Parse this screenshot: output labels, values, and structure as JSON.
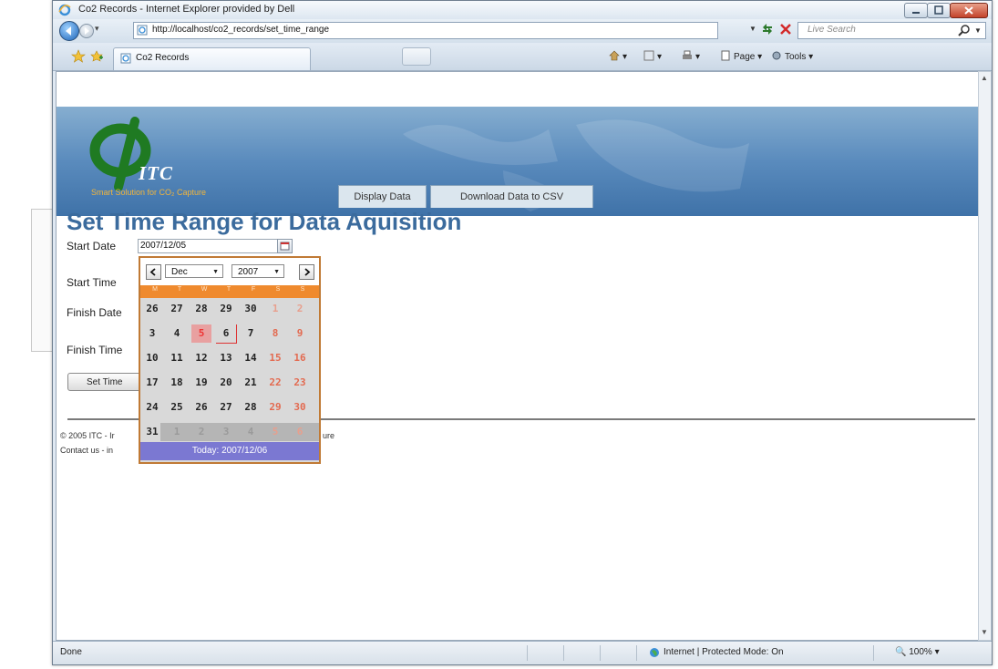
{
  "window": {
    "title": "Co2 Records - Internet Explorer provided by Dell"
  },
  "address_bar": {
    "url": "http://localhost/co2_records/set_time_range",
    "search_placeholder": "Live Search"
  },
  "tabs": [
    {
      "label": "Co2 Records"
    }
  ],
  "command_bar": {
    "page_label": "Page",
    "tools_label": "Tools"
  },
  "site": {
    "logo_text": "ITC",
    "tagline": "Smart Solution for CO₂ Capture",
    "nav": [
      {
        "label": "Display Data"
      },
      {
        "label": "Download Data to CSV"
      }
    ]
  },
  "form": {
    "title": "Set Time Range for Data Aquisition",
    "start_date_label": "Start Date",
    "start_date_value": "2007/12/05",
    "start_time_label": "Start Time",
    "finish_date_label": "Finish Date",
    "finish_time_label": "Finish Time",
    "submit_label": "Set Time"
  },
  "footer": {
    "line1": "© 2005 ITC - Ir",
    "line1_tail": "ure",
    "line2": "Contact us - in"
  },
  "calendar": {
    "month": "Dec",
    "year": "2007",
    "weekdays": [
      "M",
      "T",
      "W",
      "T",
      "F",
      "S",
      "S"
    ],
    "weeks": [
      [
        "26",
        "27",
        "28",
        "29",
        "30",
        "1",
        "2"
      ],
      [
        "3",
        "4",
        "5",
        "6",
        "7",
        "8",
        "9"
      ],
      [
        "10",
        "11",
        "12",
        "13",
        "14",
        "15",
        "16"
      ],
      [
        "17",
        "18",
        "19",
        "20",
        "21",
        "22",
        "23"
      ],
      [
        "24",
        "25",
        "26",
        "27",
        "28",
        "29",
        "30"
      ],
      [
        "31",
        "1",
        "2",
        "3",
        "4",
        "5",
        "6"
      ]
    ],
    "today_text": "Today: 2007/12/06"
  },
  "status_bar": {
    "text": "Done",
    "zone": "Internet | Protected Mode: On",
    "zoom": "100%"
  },
  "colors": {
    "page_title": "#3b6b9d",
    "calendar_header": "#ef8a2e",
    "calendar_footer": "#7b78d2",
    "tagline": "#f0b53c"
  }
}
